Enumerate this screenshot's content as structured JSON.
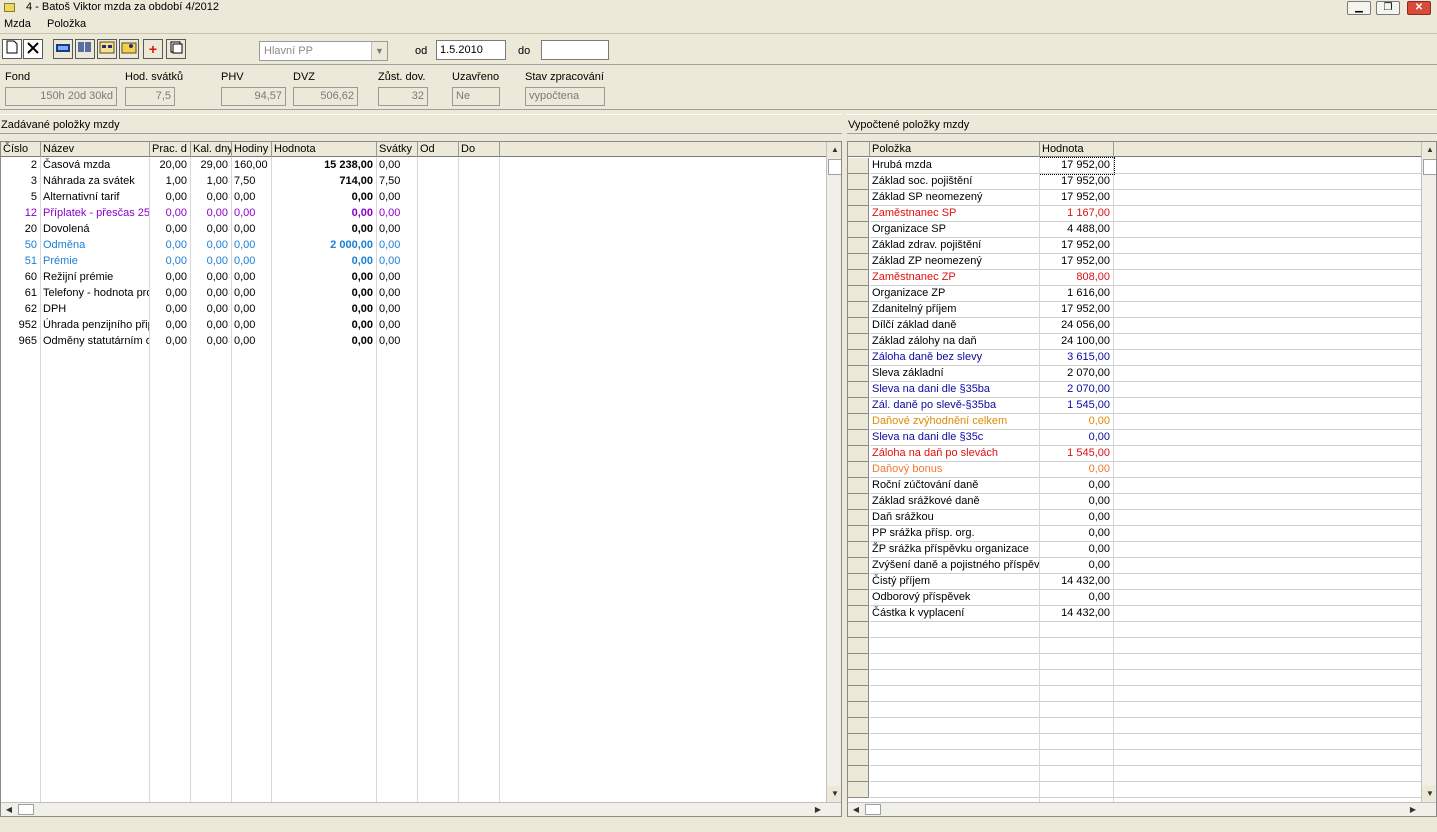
{
  "window": {
    "title": "4 - Batoš Viktor mzda za období 4/2012"
  },
  "menu": {
    "items": [
      "Mzda",
      "Položka"
    ]
  },
  "toolbar": {
    "combo_value": "Hlavní PP",
    "od_label": "od",
    "od_value": "1.5.2010",
    "do_label": "do",
    "do_value": ""
  },
  "info": {
    "fond_label": "Fond",
    "fond_value": "150h 20d 30kd",
    "hod_svatku_label": "Hod. svátků",
    "hod_svatku_value": "7,5",
    "phv_label": "PHV",
    "phv_value": "94,57",
    "dvz_label": "DVZ",
    "dvz_value": "506,62",
    "zust_dov_label": "Zůst. dov.",
    "zust_dov_value": "32",
    "uzavreno_label": "Uzavřeno",
    "uzavreno_value": "Ne",
    "stav_label": "Stav zpracování",
    "stav_value": "vypočtena"
  },
  "left_panel": {
    "title": "Zadávané položky mzdy",
    "columns": [
      "Číslo",
      "Název",
      "Prac. d",
      "Kal. dny",
      "Hodiny",
      "Hodnota",
      "Svátky",
      "Od",
      "Do"
    ],
    "rows": [
      {
        "cislo": "2",
        "nazev": "Časová mzda",
        "prac": "20,00",
        "kal": "29,00",
        "hod": "160,00",
        "hodnota": "15 238,00",
        "svatky": "0,00",
        "color": "#000000"
      },
      {
        "cislo": "3",
        "nazev": "Náhrada za svátek",
        "prac": "1,00",
        "kal": "1,00",
        "hod": "7,50",
        "hodnota": "714,00",
        "svatky": "7,50",
        "color": "#000000"
      },
      {
        "cislo": "5",
        "nazev": "Alternativní tarif",
        "prac": "0,00",
        "kal": "0,00",
        "hod": "0,00",
        "hodnota": "0,00",
        "svatky": "0,00",
        "color": "#000000"
      },
      {
        "cislo": "12",
        "nazev": "Příplatek - přesčas 25",
        "prac": "0,00",
        "kal": "0,00",
        "hod": "0,00",
        "hodnota": "0,00",
        "svatky": "0,00",
        "color": "#8b00c8"
      },
      {
        "cislo": "20",
        "nazev": "Dovolená",
        "prac": "0,00",
        "kal": "0,00",
        "hod": "0,00",
        "hodnota": "0,00",
        "svatky": "0,00",
        "color": "#000000"
      },
      {
        "cislo": "50",
        "nazev": "Odměna",
        "prac": "0,00",
        "kal": "0,00",
        "hod": "0,00",
        "hodnota": "2 000,00",
        "svatky": "0,00",
        "color": "#1a7fd8"
      },
      {
        "cislo": "51",
        "nazev": "Prémie",
        "prac": "0,00",
        "kal": "0,00",
        "hod": "0,00",
        "hodnota": "0,00",
        "svatky": "0,00",
        "color": "#1a7fd8"
      },
      {
        "cislo": "60",
        "nazev": "Režijní prémie",
        "prac": "0,00",
        "kal": "0,00",
        "hod": "0,00",
        "hodnota": "0,00",
        "svatky": "0,00",
        "color": "#000000"
      },
      {
        "cislo": "61",
        "nazev": "Telefony - hodnota pro",
        "prac": "0,00",
        "kal": "0,00",
        "hod": "0,00",
        "hodnota": "0,00",
        "svatky": "0,00",
        "color": "#000000"
      },
      {
        "cislo": "62",
        "nazev": "DPH",
        "prac": "0,00",
        "kal": "0,00",
        "hod": "0,00",
        "hodnota": "0,00",
        "svatky": "0,00",
        "color": "#000000"
      },
      {
        "cislo": "952",
        "nazev": "Úhrada penzijního přip",
        "prac": "0,00",
        "kal": "0,00",
        "hod": "0,00",
        "hodnota": "0,00",
        "svatky": "0,00",
        "color": "#000000"
      },
      {
        "cislo": "965",
        "nazev": "Odměny statutárním o",
        "prac": "0,00",
        "kal": "0,00",
        "hod": "0,00",
        "hodnota": "0,00",
        "svatky": "0,00",
        "color": "#000000"
      }
    ]
  },
  "right_panel": {
    "title": "Vypočtené položky mzdy",
    "columns": [
      "Položka",
      "Hodnota"
    ],
    "rows": [
      {
        "polozka": "Hrubá mzda",
        "hodnota": "17 952,00",
        "color": "#000000"
      },
      {
        "polozka": "Základ soc. pojištění",
        "hodnota": "17 952,00",
        "color": "#000000"
      },
      {
        "polozka": "Základ SP neomezený",
        "hodnota": "17 952,00",
        "color": "#000000"
      },
      {
        "polozka": "Zaměstnanec SP",
        "hodnota": "1 167,00",
        "color": "#e01010"
      },
      {
        "polozka": "Organizace SP",
        "hodnota": "4 488,00",
        "color": "#000000"
      },
      {
        "polozka": "Základ zdrav. pojištění",
        "hodnota": "17 952,00",
        "color": "#000000"
      },
      {
        "polozka": "Základ ZP neomezený",
        "hodnota": "17 952,00",
        "color": "#000000"
      },
      {
        "polozka": "Zaměstnanec ZP",
        "hodnota": "808,00",
        "color": "#e01010"
      },
      {
        "polozka": "Organizace ZP",
        "hodnota": "1 616,00",
        "color": "#000000"
      },
      {
        "polozka": "Zdanitelný příjem",
        "hodnota": "17 952,00",
        "color": "#000000"
      },
      {
        "polozka": "Dílčí základ daně",
        "hodnota": "24 056,00",
        "color": "#000000"
      },
      {
        "polozka": "Základ zálohy na daň",
        "hodnota": "24 100,00",
        "color": "#000000"
      },
      {
        "polozka": "Záloha daně bez slevy",
        "hodnota": "3 615,00",
        "color": "#0a0aa0"
      },
      {
        "polozka": "Sleva základní",
        "hodnota": "2 070,00",
        "color": "#000000"
      },
      {
        "polozka": "Sleva na dani dle §35ba",
        "hodnota": "2 070,00",
        "color": "#0a0aa0"
      },
      {
        "polozka": "Zál. daně po slevě-§35ba",
        "hodnota": "1 545,00",
        "color": "#0a0aa0"
      },
      {
        "polozka": "Daňové zvýhodnění celkem",
        "hodnota": "0,00",
        "color": "#e08a00"
      },
      {
        "polozka": "Sleva na dani dle §35c",
        "hodnota": "0,00",
        "color": "#0a0aa0"
      },
      {
        "polozka": "Záloha na daň po slevách",
        "hodnota": "1 545,00",
        "color": "#e01010"
      },
      {
        "polozka": "Daňový bonus",
        "hodnota": "0,00",
        "color": "#f07830"
      },
      {
        "polozka": "Roční zúčtování daně",
        "hodnota": "0,00",
        "color": "#000000"
      },
      {
        "polozka": "Základ srážkové daně",
        "hodnota": "0,00",
        "color": "#000000"
      },
      {
        "polozka": "Daň srážkou",
        "hodnota": "0,00",
        "color": "#000000"
      },
      {
        "polozka": "PP srážka přísp. org.",
        "hodnota": "0,00",
        "color": "#000000"
      },
      {
        "polozka": "ŽP srážka příspěvku organizace",
        "hodnota": "0,00",
        "color": "#000000"
      },
      {
        "polozka": "Zvýšení daně a pojistného příspěv",
        "hodnota": "0,00",
        "color": "#000000"
      },
      {
        "polozka": "Čistý příjem",
        "hodnota": "14 432,00",
        "color": "#000000"
      },
      {
        "polozka": "Odborový příspěvek",
        "hodnota": "0,00",
        "color": "#000000"
      },
      {
        "polozka": "Částka k vyplacení",
        "hodnota": "14 432,00",
        "color": "#000000"
      }
    ]
  }
}
